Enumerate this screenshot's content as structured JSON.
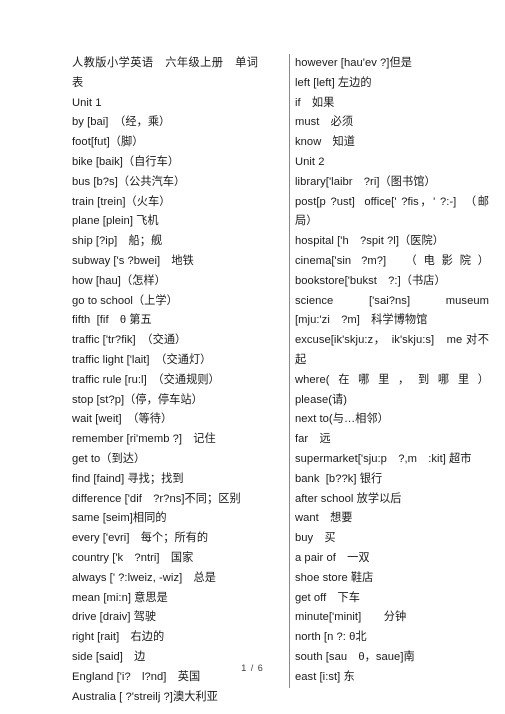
{
  "document": {
    "title": "人教版小学英语　六年级上册　单词表",
    "footer_page": "1 / 6"
  },
  "left_column": {
    "lines": [
      {
        "id": "header",
        "text": "人教版小学英语　六年级上册　单词表",
        "style": "heading"
      },
      {
        "id": "unit-1",
        "text": "Unit 1",
        "style": "unit"
      },
      {
        "id": "by",
        "text": "by [bai]　（经，乘）"
      },
      {
        "id": "foot",
        "text": "foot[fut]（脚）"
      },
      {
        "id": "bike",
        "text": "bike [baik]（自行车）"
      },
      {
        "id": "bus",
        "text": "bus [b?s]（公共汽车）"
      },
      {
        "id": "train",
        "text": "train [trein]（火车）"
      },
      {
        "id": "plane",
        "text": "plane [plein] 飞机"
      },
      {
        "id": "ship",
        "text": "ship [?ip]　船；舰"
      },
      {
        "id": "subway",
        "text": "subway ['s ?bwei]　地铁"
      },
      {
        "id": "how",
        "text": "how [hau]（怎样）"
      },
      {
        "id": "go-to-school",
        "text": "go to school（上学）"
      },
      {
        "id": "fifth",
        "text": "fifth  [fif　θ 第五"
      },
      {
        "id": "traffic",
        "text": "traffic ['tr?fik]　（交通）"
      },
      {
        "id": "traffic-light",
        "text": "traffic light ['lait]　（交通灯）"
      },
      {
        "id": "traffic-rule",
        "text": "traffic rule [ru:l]　（交通规则）"
      },
      {
        "id": "stop",
        "text": "stop [st?p]（停，停车站）"
      },
      {
        "id": "wait",
        "text": "wait [weit]　（等待）"
      },
      {
        "id": "remember",
        "text": "remember [ri'memb ?]　记住"
      },
      {
        "id": "get-to",
        "text": "get to（到达）"
      },
      {
        "id": "find",
        "text": "find [faind] 寻找；找到"
      },
      {
        "id": "difference",
        "text": "difference ['dif　?r?ns]不同；区别"
      },
      {
        "id": "same",
        "text": "same [seim]相同的"
      },
      {
        "id": "every",
        "text": "every ['evri]　每个；所有的"
      },
      {
        "id": "country",
        "text": "country ['k　?ntri]　国家"
      },
      {
        "id": "always",
        "text": "always [' ?:lweiz, -wiz]　总是"
      },
      {
        "id": "mean",
        "text": "mean [mi:n] 意思是"
      },
      {
        "id": "drive",
        "text": "drive [draiv] 驾驶"
      },
      {
        "id": "right",
        "text": "right [rait]　右边的"
      },
      {
        "id": "side",
        "text": "side [said]　边"
      },
      {
        "id": "england",
        "text": "England ['i?　l?nd]　英国"
      },
      {
        "id": "australia",
        "text": "Australia [ ?'streilj ?]澳大利亚"
      }
    ]
  },
  "right_column": {
    "lines": [
      {
        "id": "however",
        "text": "however [hau'ev ?]但是"
      },
      {
        "id": "left",
        "text": "left [left] 左边的"
      },
      {
        "id": "if",
        "text": "if　如果"
      },
      {
        "id": "must",
        "text": "must　必须"
      },
      {
        "id": "know",
        "text": "know　知道"
      },
      {
        "id": "unit-2",
        "text": "Unit 2",
        "style": "unit"
      },
      {
        "id": "library",
        "text": "library['laibr　?ri]（图书馆）"
      },
      {
        "id": "post-office",
        "text": "post[p ?ust]  office[' ?fis，' ?:-]　（邮局）",
        "style": "justify-block"
      },
      {
        "id": "hospital",
        "text": "hospital ['h　?spit ?l]（医院）"
      },
      {
        "id": "cinema",
        "text": "cinema['sin ?m?]　（电影院）",
        "style": "justify-block"
      },
      {
        "id": "bookstore",
        "text": "bookstore['bukst　?:]（书店）"
      },
      {
        "id": "science-museum",
        "text": "science　['sai?ns]　museum [mju:'zi　?m]　科学博物馆",
        "style": "justify-block"
      },
      {
        "id": "excuse-me",
        "text": "excuse[ik'skju:z，　ik'skju:s]　me 对不起",
        "style": "justify-block"
      },
      {
        "id": "where",
        "text": "where(在哪里，到哪里）",
        "style": "justify-block"
      },
      {
        "id": "please",
        "text": "please(请)"
      },
      {
        "id": "next-to",
        "text": "next to(与…相邻）"
      },
      {
        "id": "far",
        "text": "far　远"
      },
      {
        "id": "supermarket",
        "text": "supermarket['sju:p　?,m　:kit] 超市"
      },
      {
        "id": "bank",
        "text": "bank  [b??k] 银行"
      },
      {
        "id": "after-school",
        "text": "after school 放学以后"
      },
      {
        "id": "want",
        "text": "want　想要"
      },
      {
        "id": "buy",
        "text": "buy　买"
      },
      {
        "id": "a-pair-of",
        "text": "a pair of　一双"
      },
      {
        "id": "shoe-store",
        "text": "shoe store 鞋店"
      },
      {
        "id": "get-off",
        "text": "get off　下车"
      },
      {
        "id": "minute",
        "text": "minute['minit]　　分钟"
      },
      {
        "id": "north",
        "text": "north [n ?: θ北"
      },
      {
        "id": "south",
        "text": "south [sau　θ，saue]南"
      },
      {
        "id": "east",
        "text": "east [i:st] 东"
      }
    ]
  }
}
